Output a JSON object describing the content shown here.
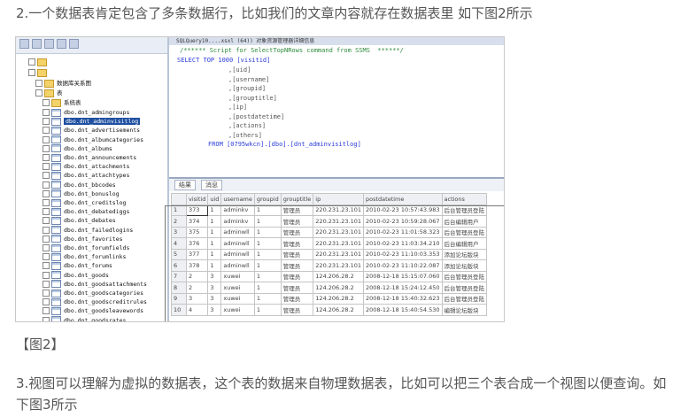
{
  "text": {
    "p1": "2.一个数据表肯定包含了多条数据行，比如我们的文章内容就存在数据表里 如下图2所示",
    "caption": "【图2】",
    "p3": "3.视图可以理解为虚拟的数据表，这个表的数据来自物理数据表，比如可以把三个表合成一个视图以便查询。如下图3所示"
  },
  "tree": {
    "folders": [
      "数据库关系图",
      "表",
      "系统表"
    ],
    "selected": "dbo.dnt_adminvisitlog",
    "tables": [
      "dbo.dnt_admingroups",
      "dbo.dnt_adminvisitlog",
      "dbo.dnt_advertisements",
      "dbo.dnt_albumcategories",
      "dbo.dnt_albums",
      "dbo.dnt_announcements",
      "dbo.dnt_attachments",
      "dbo.dnt_attachtypes",
      "dbo.dnt_bbcodes",
      "dbo.dnt_bonuslog",
      "dbo.dnt_creditslog",
      "dbo.dnt_debatediggs",
      "dbo.dnt_debates",
      "dbo.dnt_failedlogins",
      "dbo.dnt_favorites",
      "dbo.dnt_forumfields",
      "dbo.dnt_forumlinks",
      "dbo.dnt_forums",
      "dbo.dnt_goods",
      "dbo.dnt_goodsattachments",
      "dbo.dnt_goodscategories",
      "dbo.dnt_goodscreditrules",
      "dbo.dnt_goodsleavewords",
      "dbo.dnt_goodsrates"
    ]
  },
  "editor": {
    "tab": "SQLQuery10....xsxl (64))  对象资源管理器详细信息",
    "comment": "/****** Script for SelectTopNRows command from SSMS  ******/",
    "select": "SELECT TOP 1000 [visitid]",
    "cols": [
      ",[uid]",
      ",[username]",
      ",[groupid]",
      ",[grouptitle]",
      ",[ip]",
      ",[postdatetime]",
      ",[actions]",
      ",[others]"
    ],
    "from": "FROM [0795wkcn].[dbo].[dnt_adminvisitlog]"
  },
  "results": {
    "tabs": [
      "结果",
      "消息"
    ],
    "headers": [
      "",
      "visitid",
      "uid",
      "username",
      "groupid",
      "grouptitle",
      "ip",
      "postdatetime",
      "actions"
    ],
    "rows": [
      [
        "1",
        "373",
        "1",
        "adminkv",
        "1",
        "管理员",
        "220.231.23.101",
        "2010-02-23 10:57:43.983",
        "后台管理员登陆"
      ],
      [
        "2",
        "374",
        "1",
        "adminkv",
        "1",
        "管理员",
        "220.231.23.101",
        "2010-02-23 10:59:28.067",
        "后台编辑用户"
      ],
      [
        "3",
        "375",
        "1",
        "adminwll",
        "1",
        "管理员",
        "220.231.23.101",
        "2010-02-23 11:01:58.323",
        "后台管理员登陆"
      ],
      [
        "4",
        "376",
        "1",
        "adminwll",
        "1",
        "管理员",
        "220.231.23.101",
        "2010-02-23 11:03:34.210",
        "后台编辑用户"
      ],
      [
        "5",
        "377",
        "1",
        "adminwll",
        "1",
        "管理员",
        "220.231.23.101",
        "2010-02-23 11:10:03.353",
        "添加论坛版块"
      ],
      [
        "6",
        "378",
        "1",
        "adminwll",
        "1",
        "管理员",
        "220.231.23.101",
        "2010-02-23 11:10:22.087",
        "添加论坛版块"
      ],
      [
        "7",
        "2",
        "3",
        "xuwei",
        "1",
        "管理员",
        "124.206.28.2",
        "2008-12-18 15:15:07.060",
        "后台管理员登陆"
      ],
      [
        "8",
        "2",
        "3",
        "xuwei",
        "1",
        "管理员",
        "124.206.28.2",
        "2008-12-18 15:24:12.450",
        "后台管理员登陆"
      ],
      [
        "9",
        "3",
        "3",
        "xuwei",
        "1",
        "管理员",
        "124.206.28.2",
        "2008-12-18 15:40:32.623",
        "后台管理员登陆"
      ],
      [
        "10",
        "4",
        "3",
        "xuwei",
        "1",
        "管理员",
        "124.206.28.2",
        "2008-12-18 15:40:54.530",
        "编辑论坛版块"
      ]
    ]
  }
}
